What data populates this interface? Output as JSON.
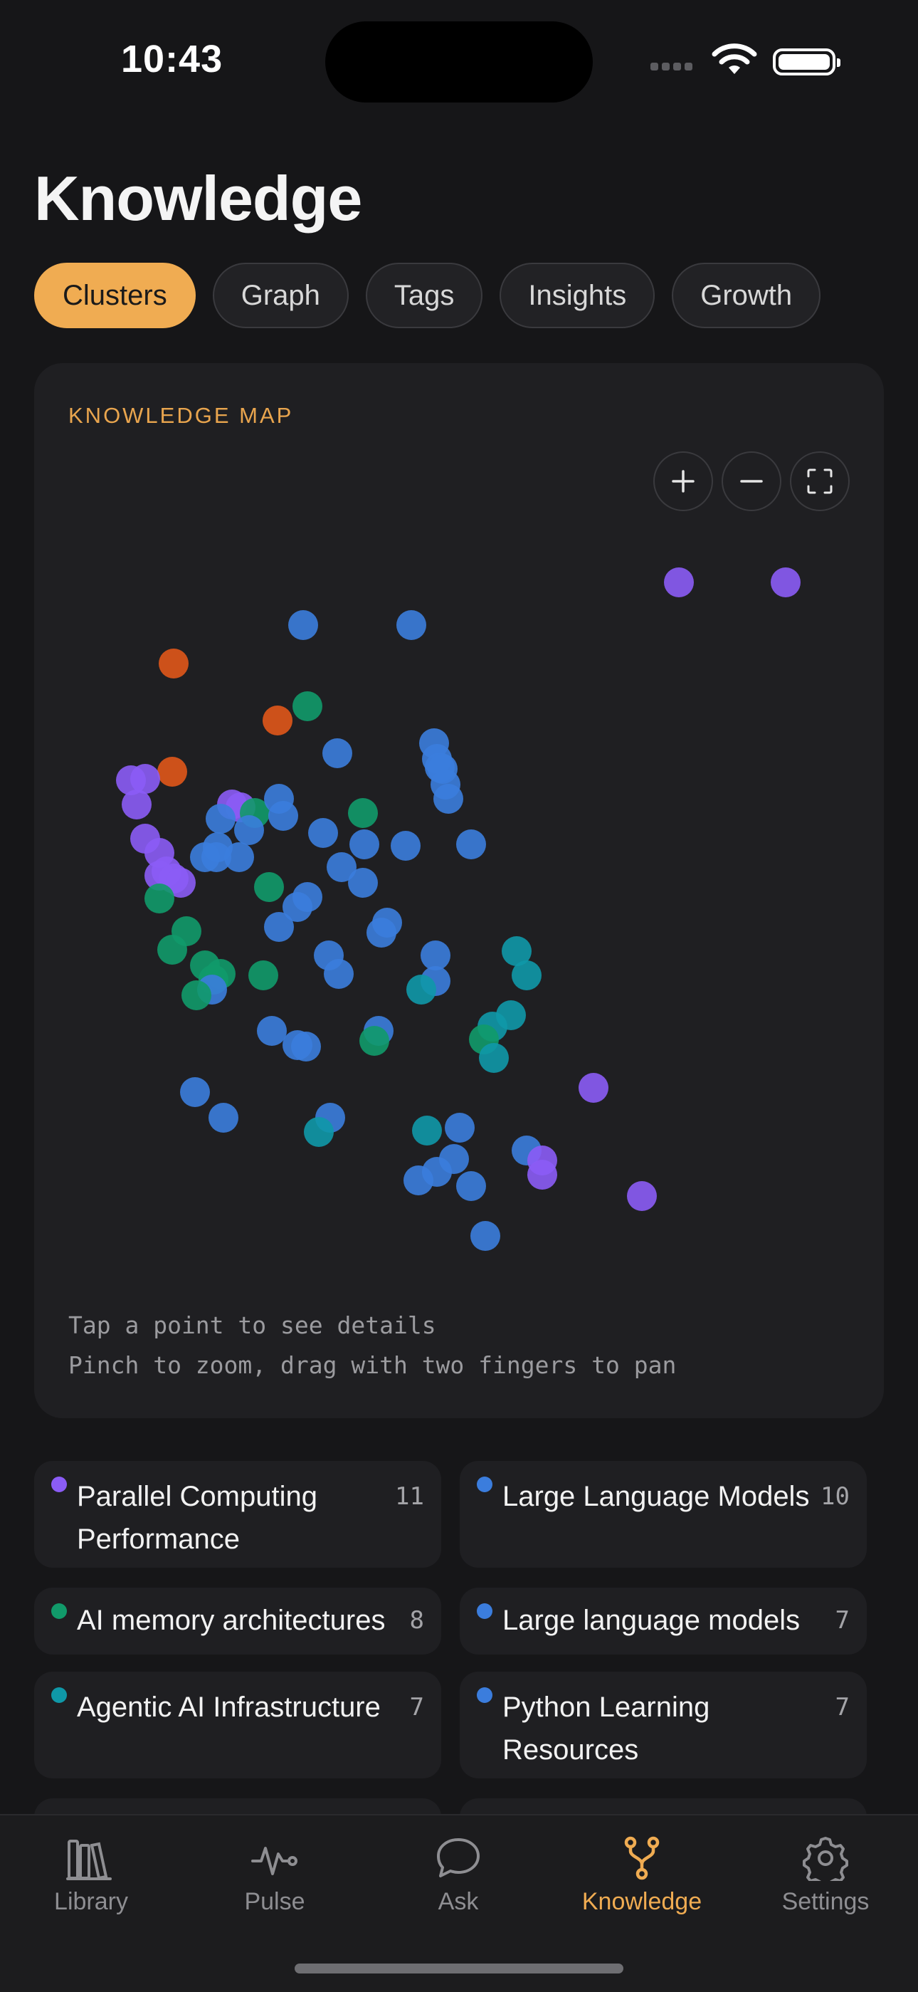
{
  "status": {
    "time": "10:43"
  },
  "page": {
    "title": "Knowledge"
  },
  "tabs": [
    {
      "label": "Clusters",
      "active": true
    },
    {
      "label": "Graph",
      "active": false
    },
    {
      "label": "Tags",
      "active": false
    },
    {
      "label": "Insights",
      "active": false
    },
    {
      "label": "Growth",
      "active": false
    }
  ],
  "map": {
    "label": "KNOWLEDGE MAP",
    "hint_1": "Tap a point to see details",
    "hint_2": "Pinch to zoom, drag with two fingers to pan",
    "zoom_in_icon": "plus-icon",
    "zoom_out_icon": "minus-icon",
    "fit_icon": "fullscreen-icon",
    "colors": {
      "purple": "#8b5cf6",
      "blue": "#3b7ddd",
      "green": "#119a6a",
      "orange": "#e0561a",
      "teal": "#0f98a8"
    }
  },
  "clusters": [
    {
      "name": "Parallel Computing Performance",
      "count": "11",
      "color": "#8b5cf6"
    },
    {
      "name": "Large Language Models",
      "count": "10",
      "color": "#3b7ddd"
    },
    {
      "name": "AI memory architectures",
      "count": "8",
      "color": "#119a6a"
    },
    {
      "name": "Large language models",
      "count": "7",
      "color": "#3b7ddd"
    },
    {
      "name": "Agentic AI Infrastructure",
      "count": "7",
      "color": "#0f98a8"
    },
    {
      "name": "Python Learning Resources",
      "count": "7",
      "color": "#3b7ddd"
    }
  ],
  "tabbar": [
    {
      "label": "Library",
      "icon": "library-icon",
      "active": false
    },
    {
      "label": "Pulse",
      "icon": "pulse-icon",
      "active": false
    },
    {
      "label": "Ask",
      "icon": "chat-bubble-icon",
      "active": false
    },
    {
      "label": "Knowledge",
      "icon": "branch-icon",
      "active": true
    },
    {
      "label": "Settings",
      "icon": "gear-icon",
      "active": false
    }
  ],
  "accent": "#f0ac52"
}
